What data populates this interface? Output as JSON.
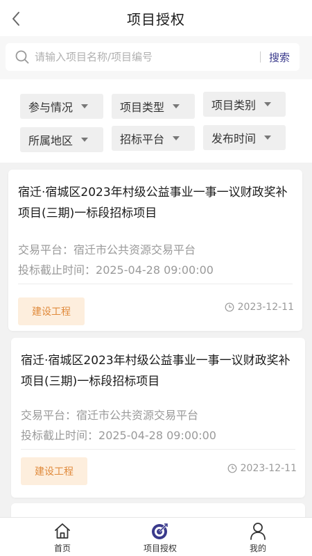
{
  "header": {
    "title": "项目授权",
    "back_icon": "chevron-left-icon"
  },
  "search": {
    "placeholder": "请输入项目名称/项目编号",
    "button_label": "搜索"
  },
  "filters": [
    {
      "label": "参与情况"
    },
    {
      "label": "项目类型"
    },
    {
      "label": "项目类别"
    },
    {
      "label": "所属地区"
    },
    {
      "label": "招标平台"
    },
    {
      "label": "发布时间"
    }
  ],
  "projects": [
    {
      "title": "宿迁·宿城区2023年村级公益事业一事一议财政奖补项目(三期)一标段招标项目",
      "platform_label": "交易平台：",
      "platform": "宿迁市公共资源交易平台",
      "deadline_label": "投标截止时间：",
      "deadline": "2025-04-28 09:00:00",
      "tag": "建设工程",
      "date": "2023-12-11"
    },
    {
      "title": "宿迁·宿城区2023年村级公益事业一事一议财政奖补项目(三期)一标段招标项目",
      "platform_label": "交易平台：",
      "platform": "宿迁市公共资源交易平台",
      "deadline_label": "投标截止时间：",
      "deadline": "2025-04-28 09:00:00",
      "tag": "建设工程",
      "date": "2023-12-11"
    }
  ],
  "nav": {
    "items": [
      {
        "label": "首页",
        "icon": "home-icon"
      },
      {
        "label": "项目授权",
        "icon": "target-icon",
        "active": true
      },
      {
        "label": "我的",
        "icon": "user-icon"
      }
    ]
  },
  "colors": {
    "tag_bg": "#fdeedd",
    "tag_text": "#e08a3b",
    "search_button": "#3a3a8c",
    "nav_active": "#3a3a8c"
  }
}
